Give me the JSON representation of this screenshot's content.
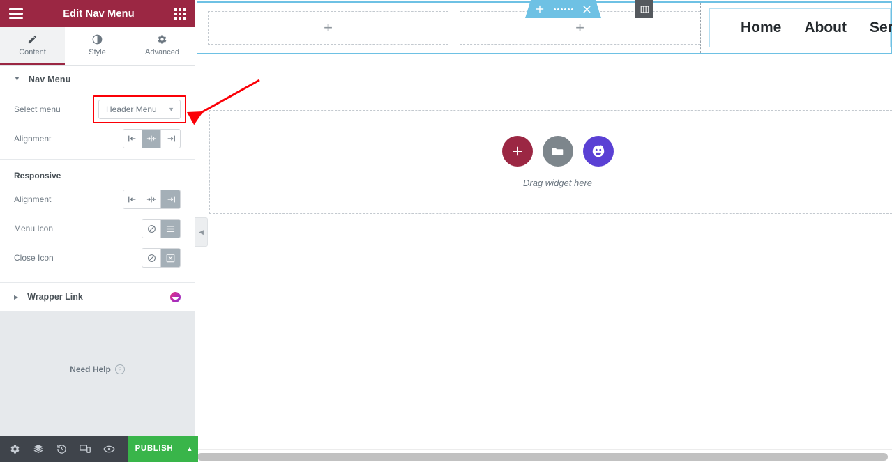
{
  "panel": {
    "header": {
      "title": "Edit Nav Menu",
      "menu_icon": "hamburger-icon",
      "apps_icon": "grid-apps-icon"
    },
    "tabs": [
      {
        "label": "Content",
        "icon": "pencil-icon",
        "active": true
      },
      {
        "label": "Style",
        "icon": "contrast-circle-icon",
        "active": false
      },
      {
        "label": "Advanced",
        "icon": "gear-icon",
        "active": false
      }
    ],
    "sections": {
      "nav_menu": {
        "title": "Nav Menu",
        "expanded": true,
        "caret": "caret-down-icon",
        "controls": {
          "select_menu": {
            "label": "Select menu",
            "value": "Header Menu",
            "chevron": "chevron-down-icon",
            "highlighted": true,
            "highlight_color": "#fb0007"
          },
          "alignment": {
            "label": "Alignment",
            "options": [
              "left",
              "center",
              "right"
            ],
            "selected": "center"
          }
        },
        "responsive": {
          "group_label": "Responsive",
          "alignment": {
            "label": "Alignment",
            "options": [
              "left",
              "center",
              "right"
            ],
            "selected": "right"
          },
          "menu_icon": {
            "label": "Menu Icon",
            "options": [
              "none",
              "hamburger"
            ],
            "selected": "hamburger"
          },
          "close_icon": {
            "label": "Close Icon",
            "options": [
              "none",
              "close-box"
            ],
            "selected": "close-box"
          }
        }
      },
      "wrapper_link": {
        "title": "Wrapper Link",
        "expanded": false,
        "caret": "caret-right-icon",
        "pro_badge": "elementor-pro-badge"
      }
    },
    "need_help": {
      "label": "Need Help",
      "icon": "question-mark-icon"
    },
    "footer": {
      "icons": [
        "settings-gear-icon",
        "navigator-layers-icon",
        "history-clock-icon",
        "responsive-mode-icon",
        "preview-eye-icon"
      ],
      "publish_label": "PUBLISH",
      "publish_color": "#39b54a",
      "publish_arrow": "caret-up-icon"
    }
  },
  "canvas": {
    "section_toolbar": {
      "add": "plus-icon",
      "drag": "drag-dots-icon",
      "close": "close-x-icon",
      "color": "#6ec1e4"
    },
    "column_handle_icon": "column-edit-icon",
    "columns": [
      {
        "placeholder_icon": "plus-icon"
      },
      {
        "placeholder_icon": "plus-icon"
      }
    ],
    "nav_menu_items": [
      "Home",
      "About",
      "Services"
    ],
    "dropzone": {
      "buttons": [
        {
          "name": "add-widget",
          "icon": "plus-icon",
          "color": "#9b2743"
        },
        {
          "name": "add-template",
          "icon": "folder-icon",
          "color": "#7d868c"
        },
        {
          "name": "ai-builder",
          "icon": "ai-face-icon",
          "color": "#5a40d4"
        }
      ],
      "text": "Drag widget here"
    },
    "collapse_icon": "chevron-left-icon"
  },
  "colors": {
    "brand": "#9b2743",
    "accent_blue": "#6ec1e4",
    "publish_green": "#39b54a",
    "annotation_red": "#fb0007"
  }
}
